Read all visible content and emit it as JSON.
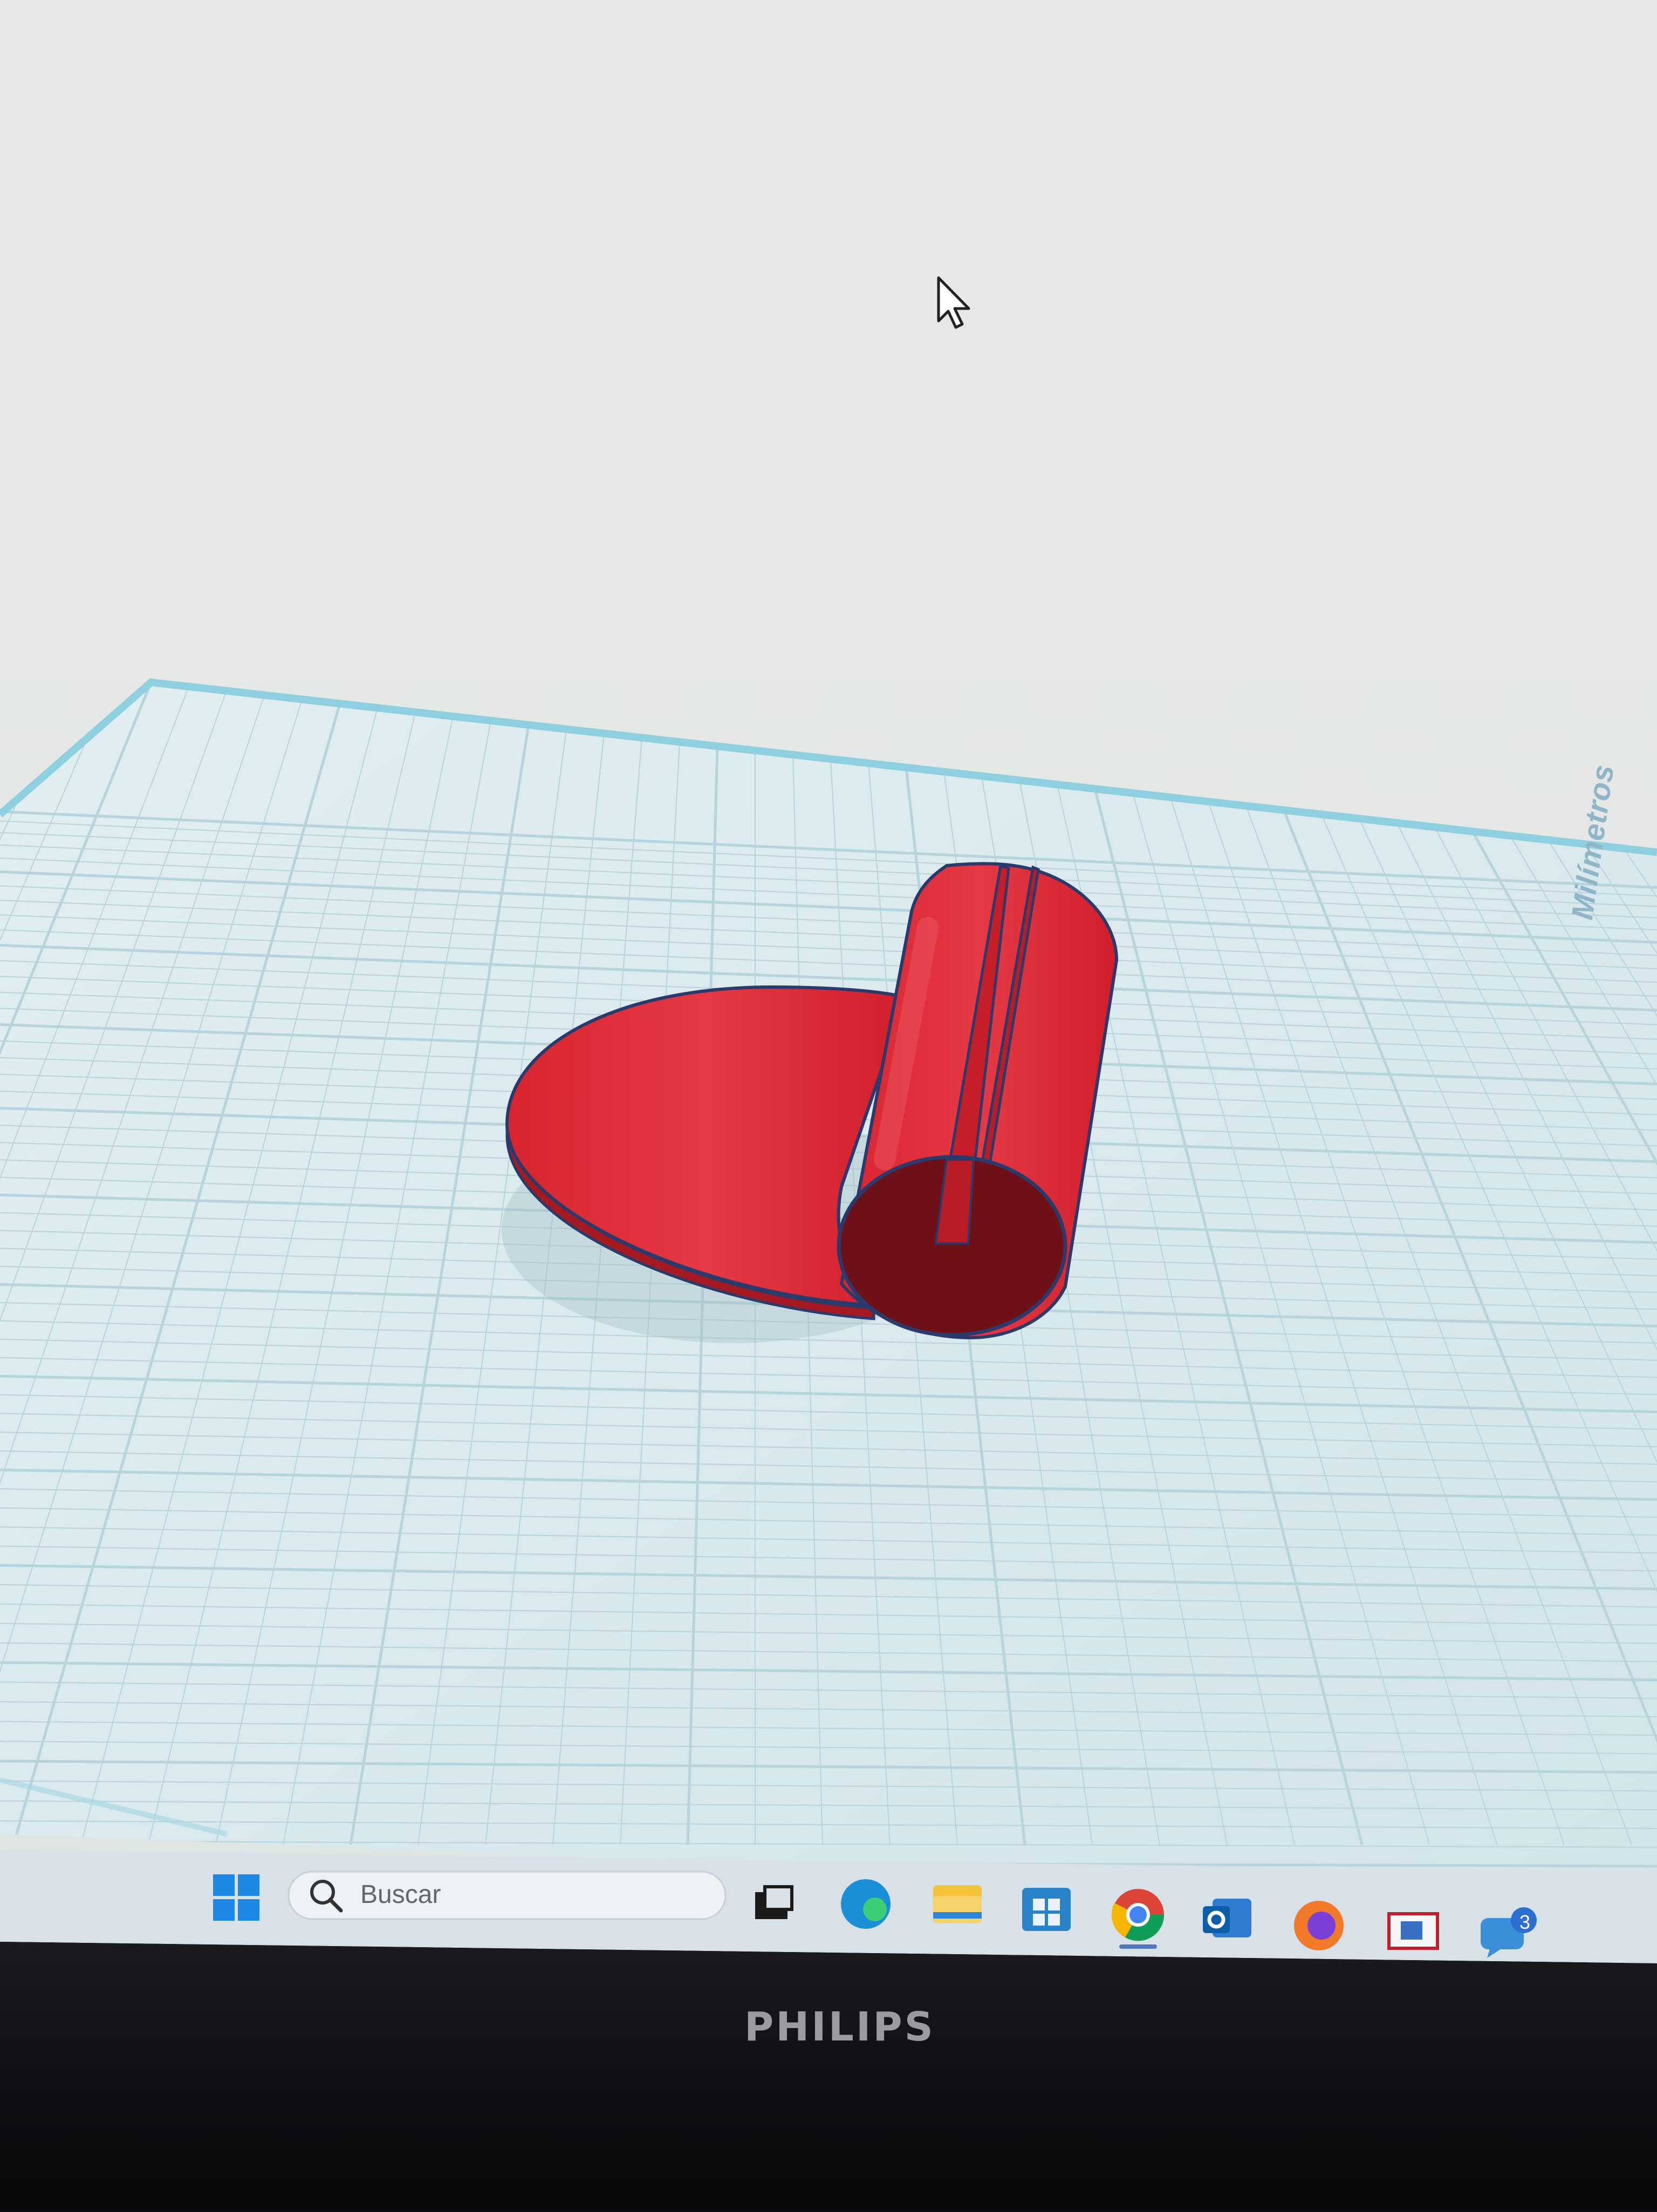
{
  "workplane": {
    "units_label": "Milímetros",
    "colors": {
      "screen_bg": "#e6e8e5",
      "plane": "#dcebef",
      "grid": "#b7d3dc",
      "plane_edge": "#8ecfe0"
    }
  },
  "model": {
    "color_main": "#d92733",
    "color_dark": "#6e1018",
    "outline": "#2b3a6a"
  },
  "taskbar": {
    "search_placeholder": "Buscar",
    "icons": [
      "windows-start-icon",
      "task-view-icon",
      "edge-icon",
      "file-explorer-icon",
      "store-icon",
      "chrome-icon",
      "outlook-icon",
      "firefox-icon",
      "window-app-icon",
      "chat-icon"
    ],
    "chat_badge_count": "3"
  },
  "monitor": {
    "brand": "PHILIPS"
  }
}
